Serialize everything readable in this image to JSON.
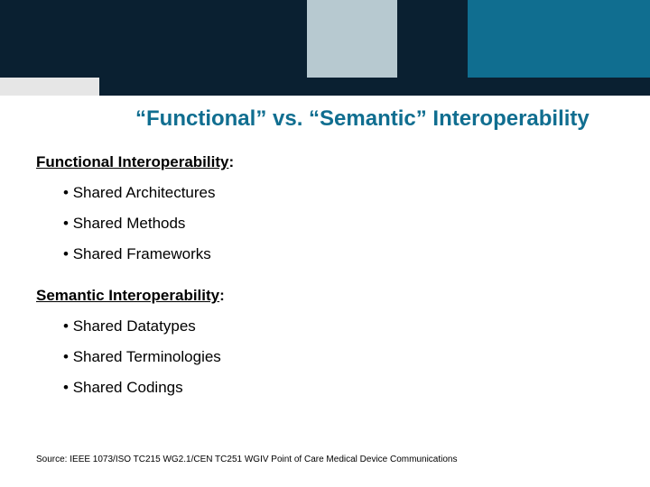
{
  "title": "“Functional” vs. “Semantic” Interoperability",
  "section1": {
    "label": "Functional Interoperability"
  },
  "section2": {
    "label": "Semantic  Interoperability"
  },
  "bullets1": {
    "b1": "Shared Architectures",
    "b2": "Shared Methods",
    "b3": "Shared Frameworks"
  },
  "bullets2": {
    "b1": "Shared Datatypes",
    "b2": "Shared Terminologies",
    "b3": "Shared Codings"
  },
  "source": "Source: IEEE 1073/ISO TC215 WG2.1/CEN TC251 WGIV  Point of Care Medical Device Communications",
  "colors": {
    "teal": "#106e90",
    "dark": "#0a2031",
    "lteal": "#b7c9d0"
  }
}
